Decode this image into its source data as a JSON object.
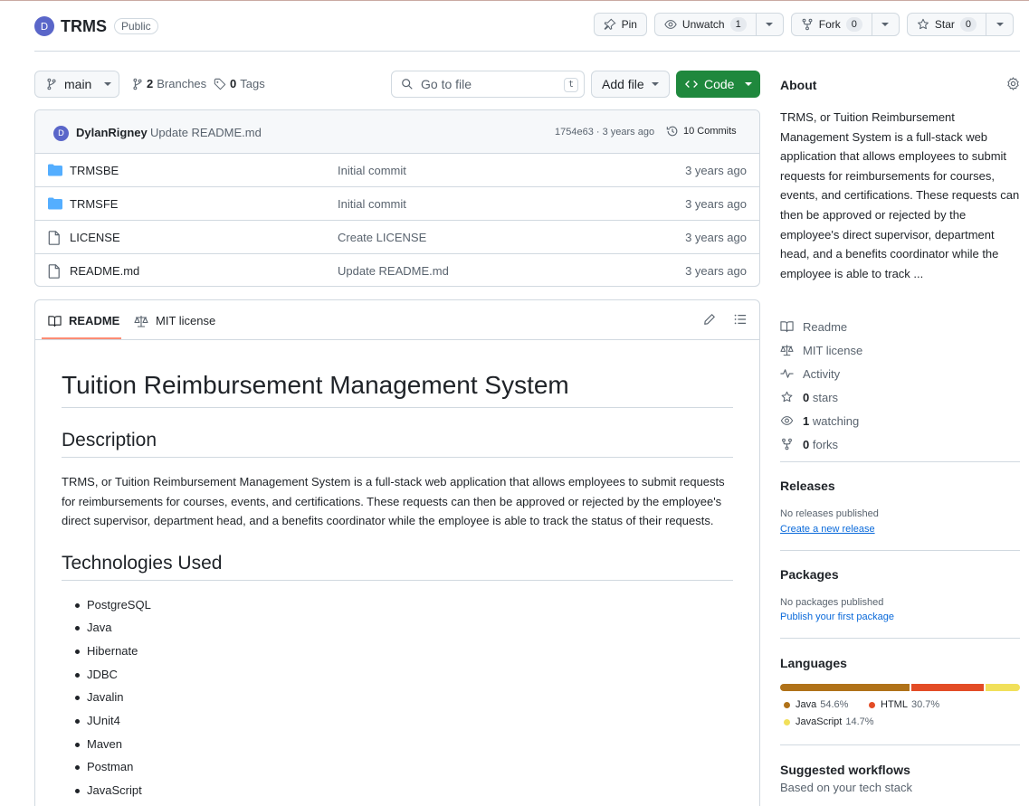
{
  "repo": {
    "avatar_letter": "D",
    "name": "TRMS",
    "visibility": "Public"
  },
  "actions": {
    "pin_label": "Pin",
    "unwatch_label": "Unwatch",
    "watch_count": "1",
    "fork_label": "Fork",
    "fork_count": "0",
    "star_label": "Star",
    "star_count": "0"
  },
  "toolbar": {
    "branch": "main",
    "branches_count": "2",
    "branches_label": "Branches",
    "tags_count": "0",
    "tags_label": "Tags",
    "goto_placeholder": "Go to file",
    "goto_shortcut": "t",
    "add_file_label": "Add file",
    "code_label": "Code"
  },
  "latest_commit": {
    "avatar_letter": "D",
    "author": "DylanRigney",
    "message": "Update README.md",
    "hash_time": "1754e63 · 3 years ago",
    "commits_label": "10 Commits"
  },
  "files": [
    {
      "type": "folder",
      "name": "TRMSBE",
      "message": "Initial commit",
      "time": "3 years ago"
    },
    {
      "type": "folder",
      "name": "TRMSFE",
      "message": "Initial commit",
      "time": "3 years ago"
    },
    {
      "type": "file",
      "name": "LICENSE",
      "message": "Create LICENSE",
      "time": "3 years ago"
    },
    {
      "type": "file",
      "name": "README.md",
      "message": "Update README.md",
      "time": "3 years ago"
    }
  ],
  "readme_tabs": {
    "readme": "README",
    "license": "MIT license"
  },
  "readme": {
    "title": "Tuition Reimbursement Management System",
    "description_heading": "Description",
    "description": "TRMS, or Tuition Reimbursement Management System is a full-stack web application that allows employees to submit requests for reimbursements for courses, events, and certifications. These requests can then be approved or rejected by the employee's direct supervisor, department head, and a benefits coordinator while the employee is able to track the status of their requests.",
    "tech_heading": "Technologies Used",
    "technologies": [
      "PostgreSQL",
      "Java",
      "Hibernate",
      "JDBC",
      "Javalin",
      "JUnit4",
      "Maven",
      "Postman",
      "JavaScript"
    ]
  },
  "sidebar": {
    "about_title": "About",
    "about_text": "TRMS, or Tuition Reimbursement Management System is a full-stack web application that allows employees to submit requests for reimbursements for courses, events, and certifications. These requests can then be approved or rejected by the employee's direct supervisor, department head, and a benefits coordinator while the employee is able to track ...",
    "links": {
      "readme": "Readme",
      "license": "MIT license",
      "activity": "Activity",
      "stars_count": "0",
      "stars_label": "stars",
      "watching_count": "1",
      "watching_label": "watching",
      "forks_count": "0",
      "forks_label": "forks"
    },
    "releases_title": "Releases",
    "releases_empty": "No releases published",
    "releases_link": "Create a new release",
    "packages_title": "Packages",
    "packages_empty": "No packages published",
    "packages_link": "Publish your first package",
    "languages_title": "Languages",
    "languages": [
      {
        "name": "Java",
        "percent": "54.6%",
        "value": 54.6,
        "color": "#b07219"
      },
      {
        "name": "HTML",
        "percent": "30.7%",
        "value": 30.7,
        "color": "#e34c26"
      },
      {
        "name": "JavaScript",
        "percent": "14.7%",
        "value": 14.7,
        "color": "#f1e05a"
      }
    ],
    "workflows_title": "Suggested workflows",
    "workflows_sub": "Based on your tech stack"
  },
  "colors": {
    "accent_green": "#1f883d",
    "link_blue": "#0969da",
    "tab_underline": "#fd8c73",
    "folder_blue": "#54aeff"
  }
}
